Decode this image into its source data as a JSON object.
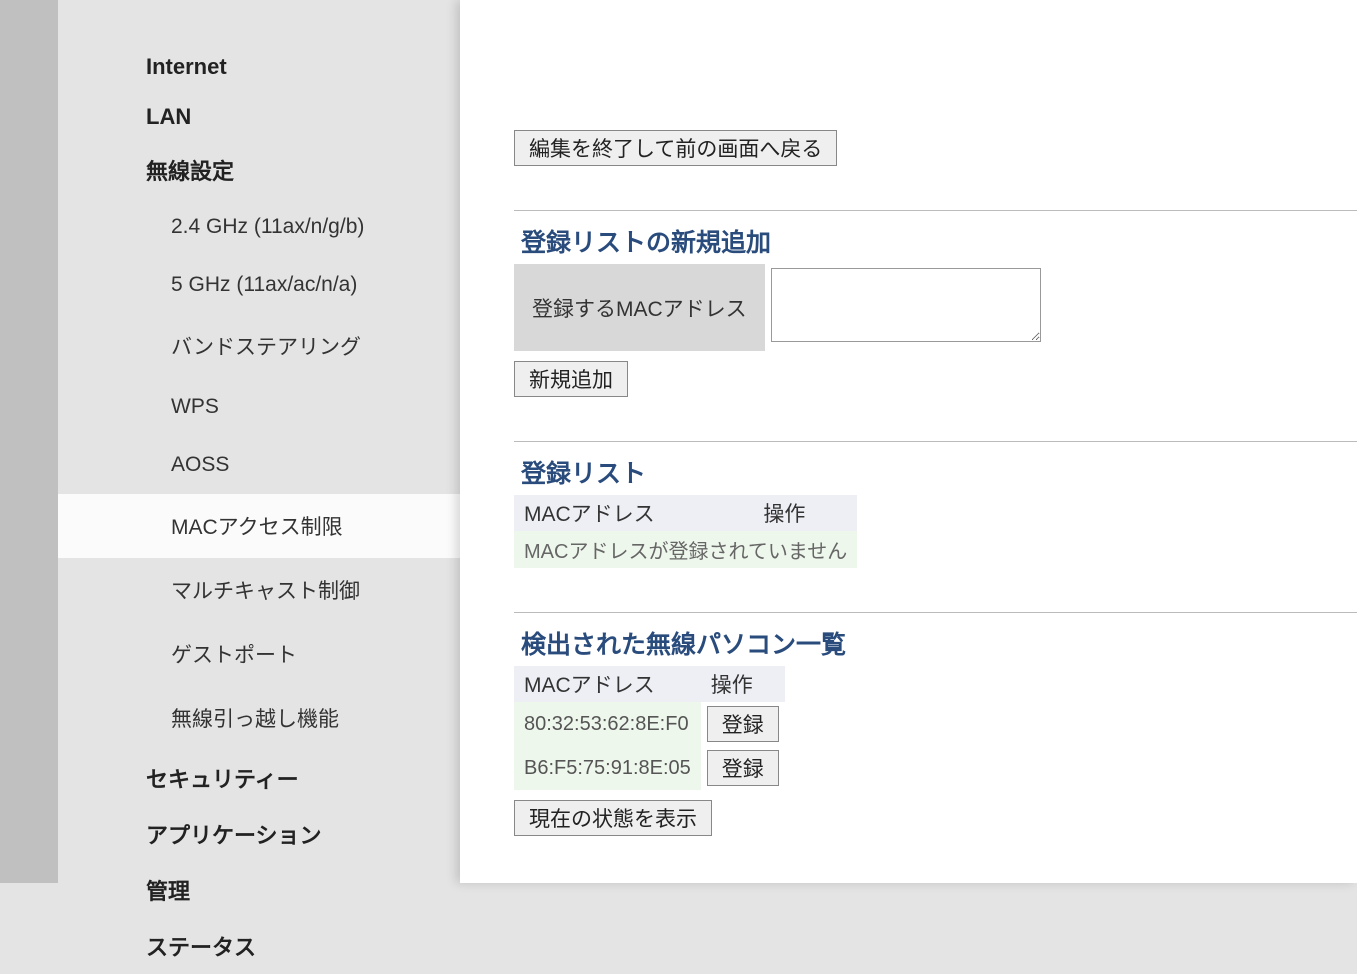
{
  "sidebar": {
    "top": [
      {
        "label": "Internet"
      },
      {
        "label": "LAN"
      },
      {
        "label": "無線設定"
      }
    ],
    "wireless_sub": [
      {
        "label": "2.4 GHz (11ax/n/g/b)"
      },
      {
        "label": "5 GHz (11ax/ac/n/a)"
      },
      {
        "label": "バンドステアリング"
      },
      {
        "label": "WPS"
      },
      {
        "label": "AOSS"
      },
      {
        "label": "MACアクセス制限",
        "active": true
      },
      {
        "label": "マルチキャスト制御"
      },
      {
        "label": "ゲストポート"
      },
      {
        "label": "無線引っ越し機能"
      }
    ],
    "bottom": [
      {
        "label": "セキュリティー"
      },
      {
        "label": "アプリケーション"
      },
      {
        "label": "管理"
      },
      {
        "label": "ステータス"
      }
    ]
  },
  "main": {
    "back_button": "編集を終了して前の画面へ戻る",
    "add_section": {
      "title": "登録リストの新規追加",
      "field_label": "登録するMACアドレス",
      "add_button": "新規追加"
    },
    "list_section": {
      "title": "登録リスト",
      "col_mac": "MACアドレス",
      "col_op": "操作",
      "empty_msg": "MACアドレスが登録されていません"
    },
    "detected_section": {
      "title": "検出された無線パソコン一覧",
      "col_mac": "MACアドレス",
      "col_op": "操作",
      "rows": [
        {
          "mac": "80:32:53:62:8E:F0",
          "btn": "登録"
        },
        {
          "mac": "B6:F5:75:91:8E:05",
          "btn": "登録"
        }
      ],
      "refresh_button": "現在の状態を表示"
    }
  }
}
